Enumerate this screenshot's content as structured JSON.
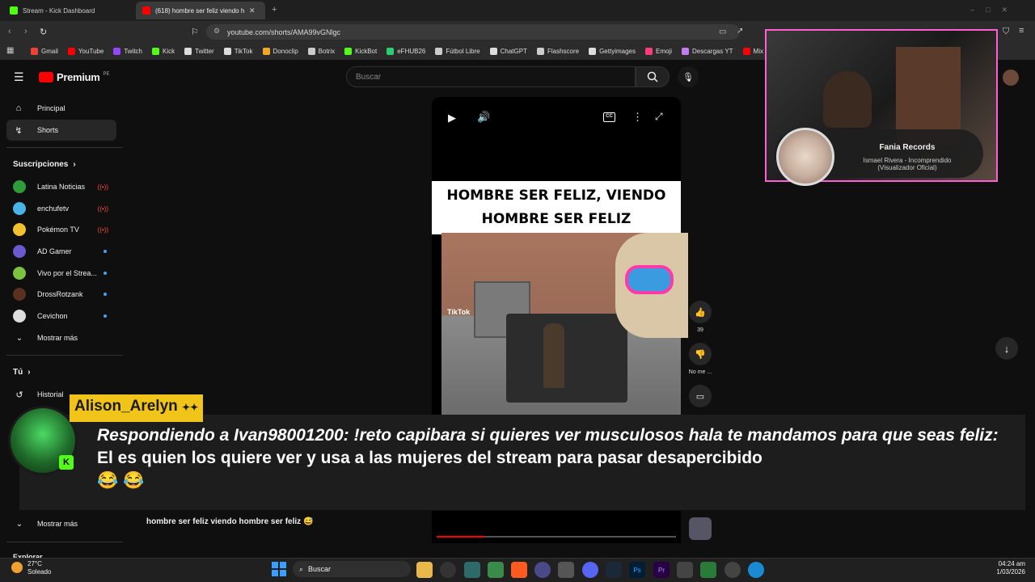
{
  "browser": {
    "tabs": [
      {
        "title": "Stream - Kick Dashboard",
        "active": false,
        "color": "#53fc18"
      },
      {
        "title": "(618) hombre ser feliz viendo ho",
        "active": true,
        "color": "#ff0000"
      }
    ],
    "url": "youtube.com/shorts/AMA99vGNlgc",
    "bookmarks": [
      {
        "label": "Gmail",
        "color": "#ea4335"
      },
      {
        "label": "YouTube",
        "color": "#ff0000"
      },
      {
        "label": "Twitch",
        "color": "#9146ff"
      },
      {
        "label": "Kick",
        "color": "#53fc18"
      },
      {
        "label": "Twitter",
        "color": "#dddddd"
      },
      {
        "label": "TikTok",
        "color": "#dddddd"
      },
      {
        "label": "Donoclip",
        "color": "#f5a623"
      },
      {
        "label": "Botrix",
        "color": "#cccccc"
      },
      {
        "label": "KickBot",
        "color": "#53fc18"
      },
      {
        "label": "eFHUB26",
        "color": "#2ecc71"
      },
      {
        "label": "Fútbol Libre",
        "color": "#cccccc"
      },
      {
        "label": "ChatGPT",
        "color": "#dddddd"
      },
      {
        "label": "Flashscore",
        "color": "#cccccc"
      },
      {
        "label": "Gettyimages",
        "color": "#dddddd"
      },
      {
        "label": "Emoji",
        "color": "#ff3b7f"
      },
      {
        "label": "Descargas YT",
        "color": "#c07cf0"
      },
      {
        "label": "Mix M",
        "color": "#ff0000"
      }
    ]
  },
  "youtube": {
    "logo": "Premium",
    "logo_badge": "PE",
    "search_placeholder": "Buscar",
    "nav": [
      {
        "label": "Principal",
        "icon": "home-icon"
      },
      {
        "label": "Shorts",
        "icon": "shorts-icon"
      }
    ],
    "subs_header": "Suscripciones",
    "subs": [
      {
        "label": "Latina Noticias",
        "color": "#2e9c3a",
        "status": "live"
      },
      {
        "label": "enchufetv",
        "color": "#4ab4e6",
        "status": "live"
      },
      {
        "label": "Pokémon TV",
        "color": "#f2c12e",
        "status": "live"
      },
      {
        "label": "AD Gamer",
        "color": "#6a5acd",
        "status": "new"
      },
      {
        "label": "Vivo por el Strea...",
        "color": "#7cc242",
        "status": "new"
      },
      {
        "label": "DrossRotzank",
        "color": "#5a3020",
        "status": "new"
      },
      {
        "label": "Cevichon",
        "color": "#dddddd",
        "status": "new"
      }
    ],
    "show_more": "Mostrar más",
    "you_header": "Tú",
    "history": "Historial",
    "show_more_2": "Mostrar más",
    "explore_partial": "Explorar",
    "video_caption_line1": "HOMBRE SER FELIZ, VIENDO",
    "video_caption_line2": "HOMBRE SER FELIZ",
    "watermark": "TikTok",
    "likes": "39",
    "dislike_label": "No me ...",
    "short_title": "hombre ser feliz  viendo hombre ser feliz 😅"
  },
  "overlay": {
    "username": "Alison_Arelyn",
    "message_em": "Respondiendo a Ivan98001200: !reto capibara si quieres ver musculosos hala te mandamos para que seas feliz:",
    "message": "El es quien los quiere ver y usa a las mujeres del stream para pasar desapercibido",
    "emojis": "😂 😂"
  },
  "webcam": {
    "artist": "Fania Records",
    "track": "Ismael Rivera - Incomprendido",
    "track_sub": "(Visualizador Oficial)"
  },
  "taskbar": {
    "temp": "27°C",
    "weather": "Soleado",
    "search": "Buscar",
    "time": "04:24 am",
    "date": "1/03/2026"
  }
}
